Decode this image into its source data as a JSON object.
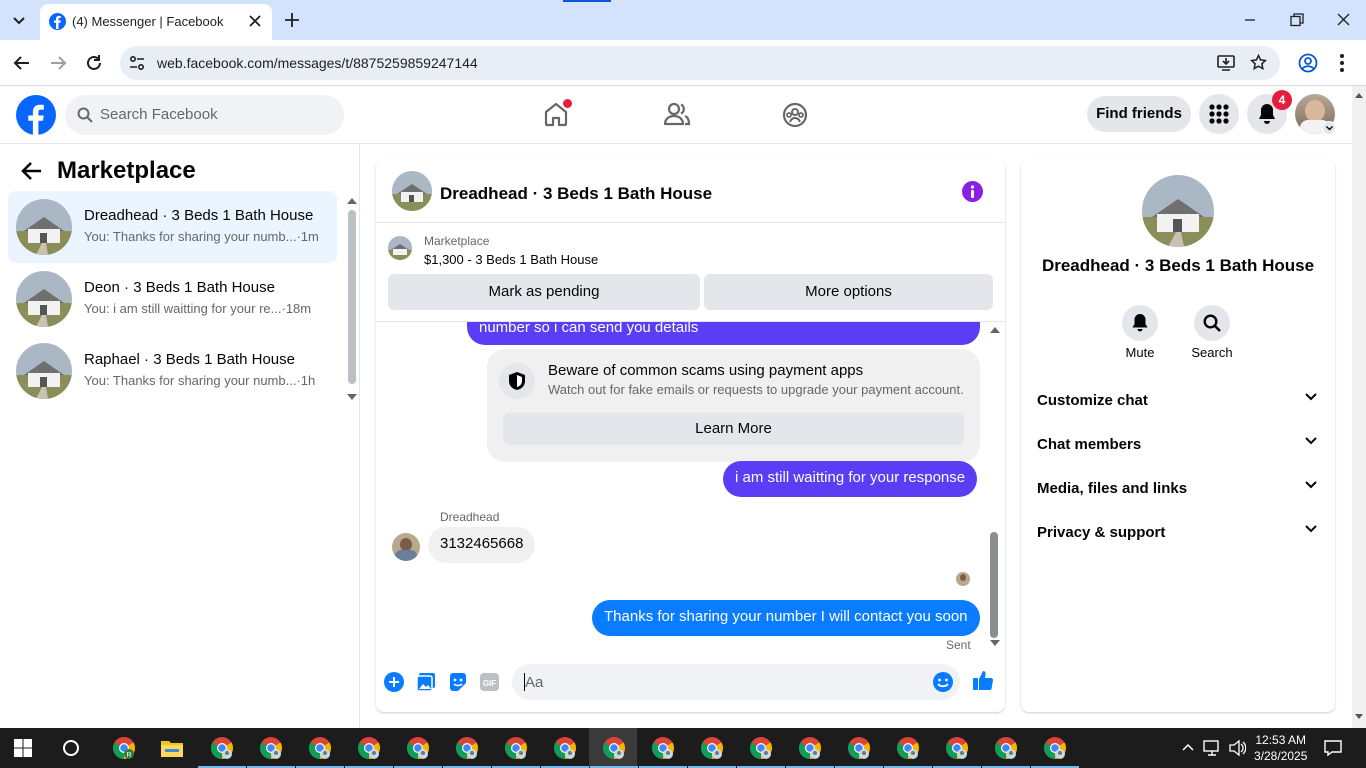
{
  "browser": {
    "tab_title": "(4) Messenger | Facebook",
    "url": "web.facebook.com/messages/t/8875259859247144"
  },
  "fb_header": {
    "search_placeholder": "Search Facebook",
    "find_friends": "Find friends",
    "notification_count": "4"
  },
  "sidebar": {
    "title": "Marketplace",
    "conversations": [
      {
        "name": "Dreadhead · 3 Beds 1 Bath House",
        "preview": "You: Thanks for sharing your numb...",
        "time": "·1m",
        "selected": true
      },
      {
        "name": "Deon · 3 Beds 1 Bath House",
        "preview": "You: i am still waitting for your re...",
        "time": "·18m",
        "selected": false
      },
      {
        "name": "Raphael · 3 Beds 1 Bath House",
        "preview": "You: Thanks for sharing your numb...",
        "time": "·1h",
        "selected": false
      }
    ]
  },
  "chat": {
    "title": "Dreadhead · 3 Beds 1 Bath House",
    "marketplace_label": "Marketplace",
    "listing": "$1,300 - 3 Beds 1 Bath House",
    "mark_pending": "Mark as pending",
    "more_options": "More options",
    "messages": {
      "partial_out": "number so i can send you  details",
      "scam_title": "Beware of common scams using payment apps",
      "scam_desc": "Watch out for fake emails or requests to upgrade your payment account.",
      "learn_more": "Learn More",
      "out_1": "i am still waitting for your response",
      "sender_name": "Dreadhead",
      "in_1": "3132465668",
      "out_2": "Thanks for sharing your number I will contact you soon",
      "status": "Sent"
    },
    "composer_placeholder": "Aa",
    "accent_color": "#5b3df5"
  },
  "info_panel": {
    "name": "Dreadhead · 3 Beds 1 Bath House",
    "mute": "Mute",
    "search": "Search",
    "sections": [
      "Customize chat",
      "Chat members",
      "Media, files and links",
      "Privacy & support"
    ]
  },
  "taskbar": {
    "time": "12:53 AM",
    "date": "3/28/2025"
  }
}
